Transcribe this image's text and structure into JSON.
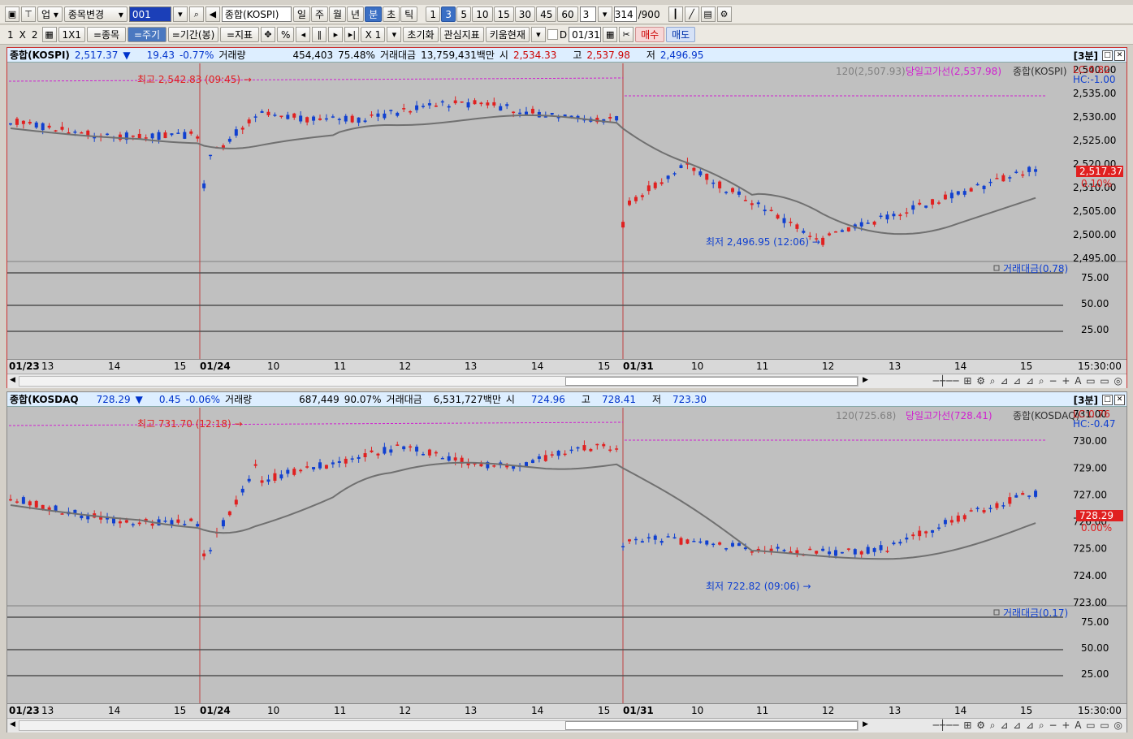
{
  "toolbar1": {
    "market_label": "업",
    "change_stock_label": "종목변경",
    "code_value": "001",
    "index_name": "종합(KOSPI)",
    "periods": [
      "일",
      "주",
      "월",
      "년",
      "분",
      "초",
      "틱"
    ],
    "active_period": "분",
    "intervals": [
      "1",
      "3",
      "5",
      "10",
      "15",
      "30",
      "45",
      "60"
    ],
    "active_interval": "3",
    "interval_select": "3",
    "count_value": "314",
    "count_max": "/900"
  },
  "toolbar2": {
    "layout_labels": [
      "1",
      "X",
      "2"
    ],
    "grid_label": "1X1",
    "stock_btn": "=종목",
    "period_btn": "=주기",
    "range_btn": "=기간(봉)",
    "indicator_btn": "=지표",
    "percent_btn": "%",
    "zoom_label": "X 1",
    "reset_btn": "초기화",
    "watch_btn": "관심지표",
    "kiwoom_btn": "키움현재",
    "d_label": "D",
    "date_value": "01/31",
    "buy_btn": "매수",
    "sell_btn": "매도"
  },
  "kospi": {
    "header": {
      "name": "종합(KOSPI)",
      "price": "2,517.37",
      "arrow": "▼",
      "change": "19.43",
      "pct": "-0.77%",
      "vol_label": "거래량",
      "vol": "454,403",
      "vol_pct": "75.48%",
      "amt_label": "거래대금",
      "amt": "13,759,431백만",
      "open_label": "시",
      "open": "2,534.33",
      "high_label": "고",
      "high": "2,537.98",
      "low_label": "저",
      "low": "2,496.95",
      "tf": "[3분]"
    },
    "legend_ma": "120(2,507.93)",
    "legend_highline": "당일고가선(2,537.98)",
    "legend_name": "종합(KOSPI)",
    "lc": "LC:0.82",
    "hc": "HC:-1.00",
    "price_ticks": [
      "2,540.00",
      "2,535.00",
      "2,530.00",
      "2,525.00",
      "2,520.00",
      "2,510.00",
      "2,505.00",
      "2,500.00",
      "2,495.00"
    ],
    "current_price": "2,517.37",
    "current_pct": "0.10%",
    "high_annot": "최고 2,542.83 (09:45)",
    "low_annot": "최저 2,496.95 (12:06)",
    "sub_legend": "거래대금(0.78)",
    "sub_ticks": [
      "75.00",
      "50.00",
      "25.00"
    ],
    "axis_labels": [
      "01/23",
      "13",
      "14",
      "15",
      "01/24",
      "10",
      "11",
      "12",
      "13",
      "14",
      "15",
      "01/31",
      "10",
      "11",
      "12",
      "13",
      "14",
      "15"
    ],
    "axis_end": "15:30:00",
    "colors": {
      "up": "#e02020",
      "down": "#1040d0",
      "ma": "#707070",
      "highline": "#d020d0"
    }
  },
  "kosdaq": {
    "header": {
      "name": "종합(KOSDAQ",
      "price": "728.29",
      "arrow": "▼",
      "change": "0.45",
      "pct": "-0.06%",
      "vol_label": "거래량",
      "vol": "687,449",
      "vol_pct": "90.07%",
      "amt_label": "거래대금",
      "amt": "6,531,727백만",
      "open_label": "시",
      "open": "724.96",
      "high_label": "고",
      "high": "728.41",
      "low_label": "저",
      "low": "723.30",
      "tf": "[3분]"
    },
    "legend_ma": "120(725.68)",
    "legend_highline": "당일고가선(728.41)",
    "legend_name": "종합(KOSDAQ)",
    "lc": "LC:0.76",
    "hc": "HC:-0.47",
    "price_ticks": [
      "731.00",
      "730.00",
      "729.00",
      "727.00",
      "726.00",
      "725.00",
      "724.00",
      "723.00"
    ],
    "current_price": "728.29",
    "current_pct": "0.00%",
    "high_annot": "최고 731.70 (12:18)",
    "low_annot": "최저 722.82 (09:06)",
    "sub_legend": "거래대금(0.17)",
    "sub_ticks": [
      "75.00",
      "50.00",
      "25.00"
    ],
    "axis_labels": [
      "01/23",
      "13",
      "14",
      "15",
      "01/24",
      "10",
      "11",
      "12",
      "13",
      "14",
      "15",
      "01/31",
      "10",
      "11",
      "12",
      "13",
      "14",
      "15"
    ],
    "axis_end": "15:30:00"
  }
}
